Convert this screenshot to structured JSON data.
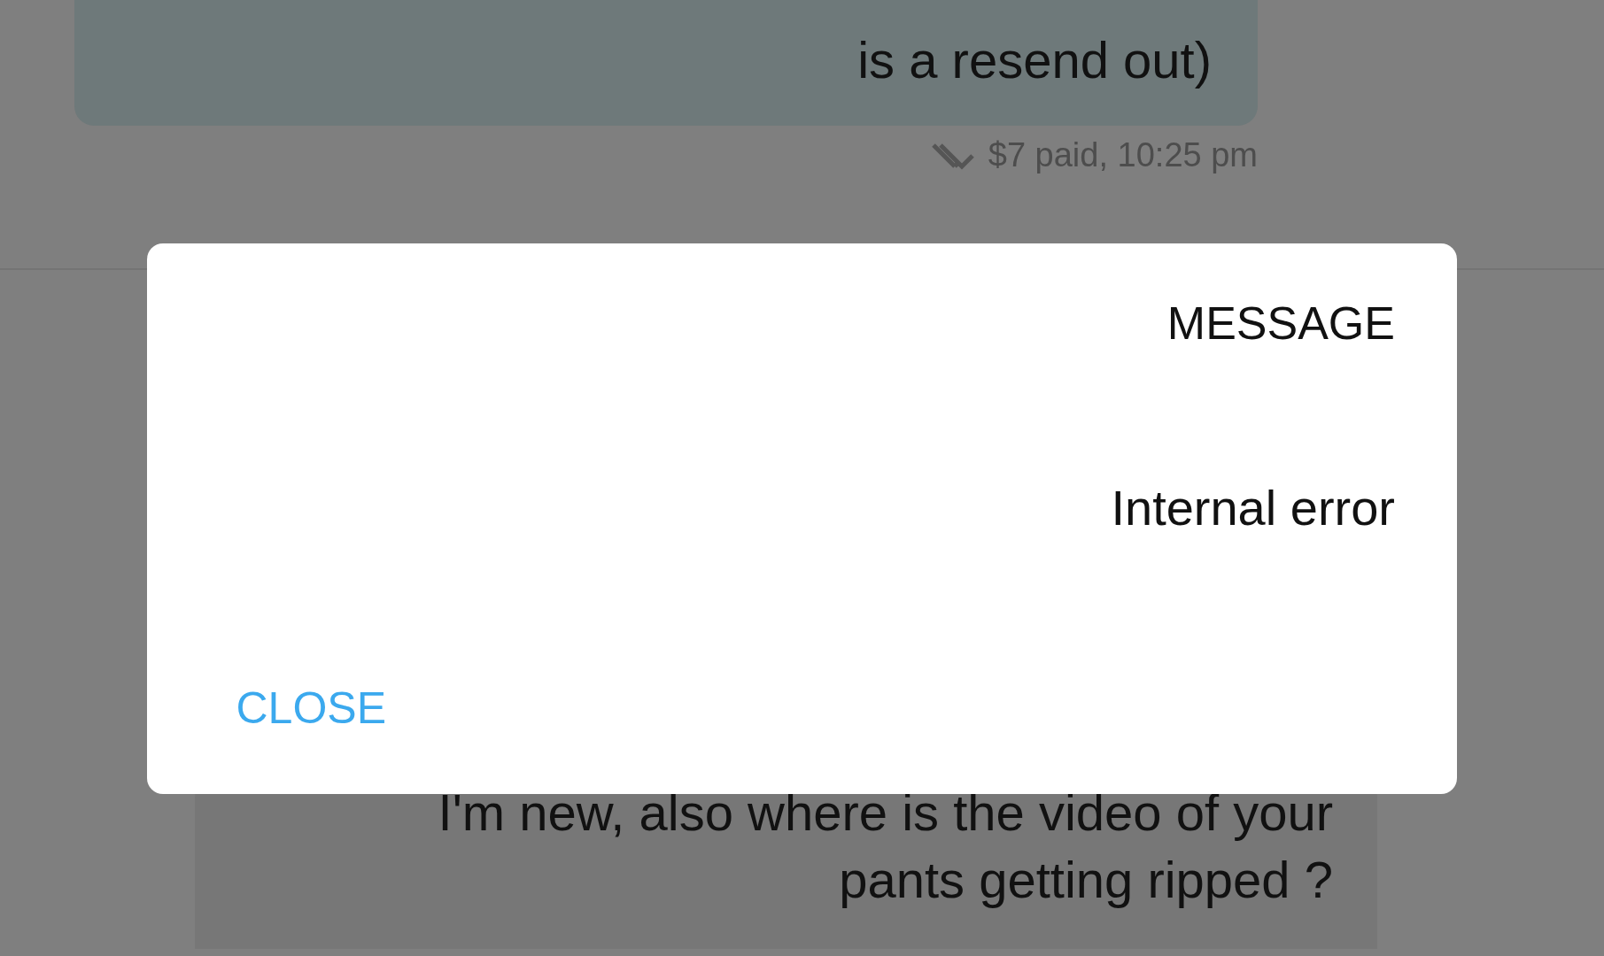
{
  "conversation": {
    "messages": [
      {
        "kind": "sent",
        "lines": [
          "is a resend out)"
        ],
        "meta": "$7 paid, 10:25 pm",
        "read": true
      },
      {
        "kind": "received",
        "lines": [
          "I'm new, also where is the video of your",
          "pants getting ripped ?"
        ]
      }
    ]
  },
  "dialog": {
    "title": "MESSAGE",
    "body": "Internal error",
    "buttons": [
      "CLOSE"
    ]
  }
}
